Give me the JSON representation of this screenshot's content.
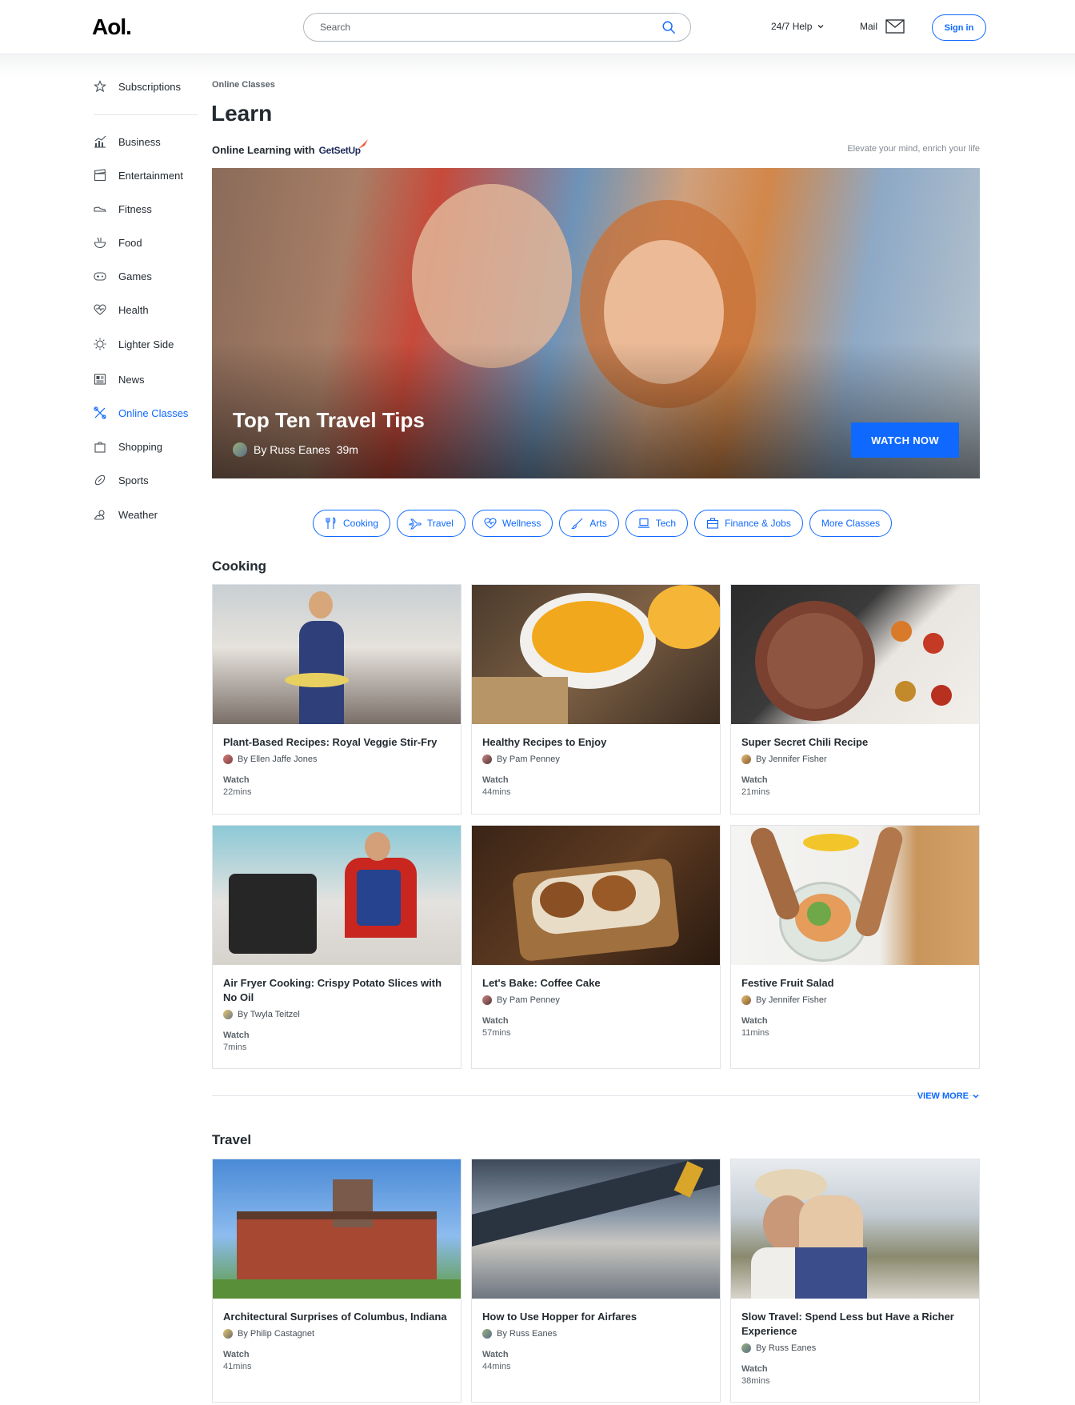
{
  "header": {
    "logo": "Aol.",
    "search_placeholder": "Search",
    "help_label": "24/7 Help",
    "mail_label": "Mail",
    "signin_label": "Sign in"
  },
  "sidebar": {
    "items": [
      {
        "label": "Subscriptions",
        "icon": "star-icon"
      },
      {
        "label": "Business",
        "icon": "chart-icon"
      },
      {
        "label": "Entertainment",
        "icon": "clapperboard-icon"
      },
      {
        "label": "Fitness",
        "icon": "sneaker-icon"
      },
      {
        "label": "Food",
        "icon": "bowl-icon"
      },
      {
        "label": "Games",
        "icon": "gamepad-icon"
      },
      {
        "label": "Health",
        "icon": "heart-pulse-icon"
      },
      {
        "label": "Lighter Side",
        "icon": "sun-icon"
      },
      {
        "label": "News",
        "icon": "newspaper-icon"
      },
      {
        "label": "Online Classes",
        "icon": "tools-icon"
      },
      {
        "label": "Shopping",
        "icon": "shopping-bag-icon"
      },
      {
        "label": "Sports",
        "icon": "football-icon"
      },
      {
        "label": "Weather",
        "icon": "partly-cloudy-icon"
      }
    ],
    "active": "Online Classes"
  },
  "main": {
    "breadcrumb": "Online Classes",
    "title": "Learn",
    "subtitle": "Online Learning with",
    "brand": "GetSetUp",
    "tagline": "Elevate your mind, enrich your life",
    "hero": {
      "title": "Top Ten Travel Tips",
      "author": "By Russ Eanes",
      "duration": "39m",
      "cta": "WATCH NOW"
    },
    "categories": [
      {
        "label": "Cooking",
        "icon": "utensils-icon"
      },
      {
        "label": "Travel",
        "icon": "airplane-icon"
      },
      {
        "label": "Wellness",
        "icon": "heart-icon"
      },
      {
        "label": "Arts",
        "icon": "brush-icon"
      },
      {
        "label": "Tech",
        "icon": "laptop-icon"
      },
      {
        "label": "Finance & Jobs",
        "icon": "briefcase-icon"
      },
      {
        "label": "More Classes",
        "icon": ""
      }
    ],
    "cooking": {
      "heading": "Cooking",
      "cards": [
        {
          "title": "Plant-Based Recipes: Royal Veggie Stir-Fry",
          "author": "By Ellen Jaffe Jones",
          "watch": "Watch",
          "duration": "22mins"
        },
        {
          "title": "Healthy Recipes to Enjoy",
          "author": "By Pam Penney",
          "watch": "Watch",
          "duration": "44mins"
        },
        {
          "title": "Super Secret Chili Recipe",
          "author": "By Jennifer Fisher",
          "watch": "Watch",
          "duration": "21mins"
        },
        {
          "title": "Air Fryer Cooking: Crispy Potato Slices with No Oil",
          "author": "By Twyla Teitzel",
          "watch": "Watch",
          "duration": "7mins"
        },
        {
          "title": "Let's Bake: Coffee Cake",
          "author": "By Pam Penney",
          "watch": "Watch",
          "duration": "57mins"
        },
        {
          "title": "Festive Fruit Salad",
          "author": "By Jennifer Fisher",
          "watch": "Watch",
          "duration": "11mins"
        }
      ],
      "view_more": "VIEW MORE"
    },
    "travel": {
      "heading": "Travel",
      "cards": [
        {
          "title": "Architectural Surprises of Columbus, Indiana",
          "author": "By Philip Castagnet",
          "watch": "Watch",
          "duration": "41mins"
        },
        {
          "title": "How to Use Hopper for Airfares",
          "author": "By Russ Eanes",
          "watch": "Watch",
          "duration": "44mins"
        },
        {
          "title": "Slow Travel: Spend Less but Have a Richer Experience",
          "author": "By Russ Eanes",
          "watch": "Watch",
          "duration": "38mins"
        }
      ]
    }
  },
  "colors": {
    "accent": "#0f69ff",
    "text": "#232a31",
    "muted": "#5b636a"
  }
}
